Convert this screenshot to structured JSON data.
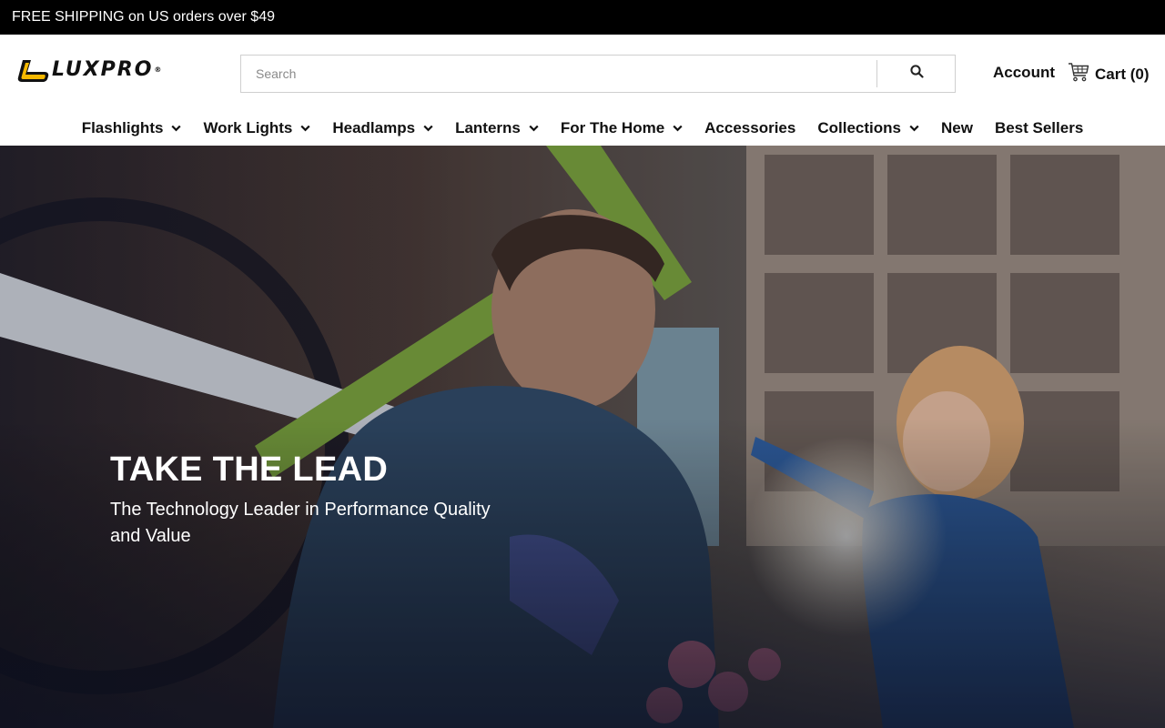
{
  "announcement": "FREE SHIPPING on US orders over $49",
  "brand": {
    "name": "LUXPRO",
    "reg": "®",
    "accent": "#f5b800"
  },
  "search": {
    "placeholder": "Search",
    "value": "",
    "icon": "search-icon"
  },
  "account": {
    "label": "Account"
  },
  "cart": {
    "label": "Cart (0)",
    "icon": "cart-icon"
  },
  "nav": {
    "items": [
      {
        "label": "Flashlights",
        "dropdown": true
      },
      {
        "label": "Work Lights",
        "dropdown": true
      },
      {
        "label": "Headlamps",
        "dropdown": true
      },
      {
        "label": "Lanterns",
        "dropdown": true
      },
      {
        "label": "For The Home",
        "dropdown": true
      },
      {
        "label": "Accessories",
        "dropdown": false
      },
      {
        "label": "Collections",
        "dropdown": true
      },
      {
        "label": "New",
        "dropdown": false
      },
      {
        "label": "Best Sellers",
        "dropdown": false
      }
    ]
  },
  "hero": {
    "title": "TAKE THE LEAD",
    "subtitle": "The Technology Leader in Performance Quality and Value"
  }
}
